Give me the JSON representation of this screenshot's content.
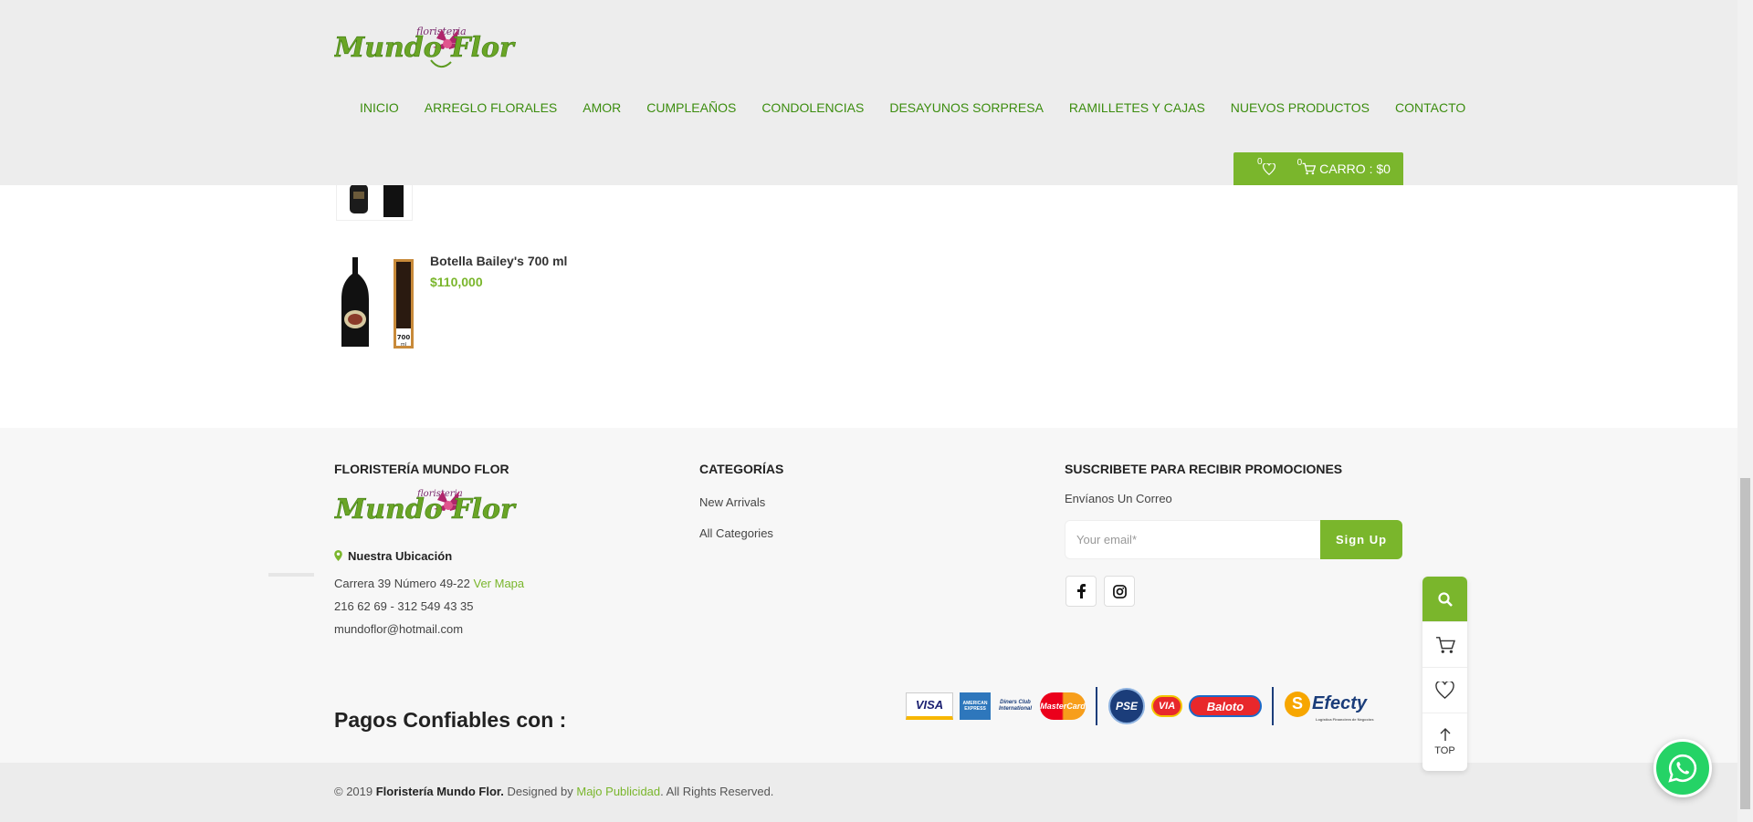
{
  "header": {
    "brand_small": "floristeria",
    "brand_main": "Mundo Flor",
    "nav": [
      "INICIO",
      "ARREGLO FLORALES",
      "AMOR",
      "CUMPLEAÑOS",
      "CONDOLENCIAS",
      "DESAYUNOS SORPRESA",
      "RAMILLETES Y CAJAS",
      "NUEVOS PRODUCTOS",
      "CONTACTO"
    ],
    "wishlist_count": "0",
    "cart_count": "0",
    "cart_label": "CARRO : $0"
  },
  "products": [
    {
      "name": "Botella Bailey's 700 ml",
      "price": "$110,000",
      "label_text": "CREMA DE WHISKY",
      "size_text": "700 ml"
    }
  ],
  "footer": {
    "col1_title": "FLORISTERÍA MUNDO FLOR",
    "location_label": "Nuestra Ubicación",
    "address": "Carrera 39 Número 49-22",
    "map_link": "Ver Mapa",
    "phones": "216 62 69 - 312 549 43 35",
    "email": "mundoflor@hotmail.com",
    "col2_title": "CATEGORÍAS",
    "categories": [
      "New Arrivals",
      "All Categories"
    ],
    "col3_title": "SUSCRIBETE PARA RECIBIR PROMOCIONES",
    "newsletter_sub": "Envíanos Un Correo",
    "email_placeholder": "Your email*",
    "signup_label": "Sign Up",
    "pagos_label": "Pagos Confiables con :",
    "payments": [
      "VISA",
      "AMERICAN EXPRESS",
      "Diners Club International",
      "MasterCard",
      "PSE",
      "VIA",
      "Baloto",
      "Efecty"
    ],
    "efecty_tagline": "Logística Financiera de Negocios"
  },
  "copyright": {
    "prefix": "© 2019 ",
    "company": "Floristería Mundo Flor.",
    "designed_by": " Designed by ",
    "designer": "Majo Publicidad",
    "suffix": ". All Rights Reserved."
  },
  "side_toolbar": {
    "top_label": "TOP"
  },
  "colors": {
    "accent": "#7ab62c",
    "nav_text": "#3c8d0f",
    "header_bg": "#ededed",
    "footer_bg": "#f7f7f7",
    "whatsapp": "#25d366"
  },
  "icons": [
    "heart-icon",
    "cart-icon",
    "map-pin-icon",
    "facebook-icon",
    "instagram-icon",
    "search-icon",
    "arrow-up-icon",
    "whatsapp-icon"
  ]
}
